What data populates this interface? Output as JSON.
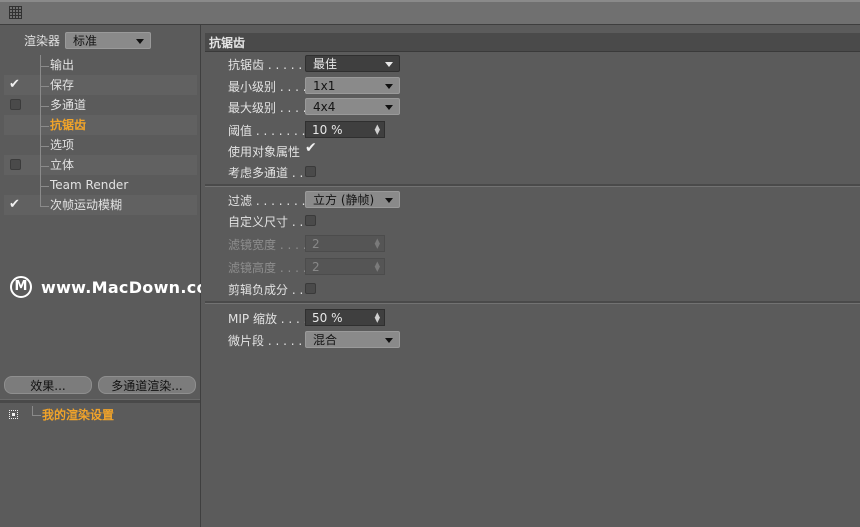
{
  "window": {
    "grip_icon": "grip-icon"
  },
  "sidebar": {
    "renderer_label": "渲染器",
    "renderer_value": "标准",
    "items": [
      {
        "label": "输出",
        "checkbox": false,
        "checked": false,
        "active": false
      },
      {
        "label": "保存",
        "checkbox": true,
        "checked": true,
        "active": false
      },
      {
        "label": "多通道",
        "checkbox": true,
        "checked": false,
        "active": false
      },
      {
        "label": "抗锯齿",
        "checkbox": false,
        "checked": false,
        "active": true
      },
      {
        "label": "选项",
        "checkbox": false,
        "checked": false,
        "active": false
      },
      {
        "label": "立体",
        "checkbox": true,
        "checked": false,
        "active": false
      },
      {
        "label": "Team Render",
        "checkbox": false,
        "checked": false,
        "active": false
      },
      {
        "label": "次帧运动模糊",
        "checkbox": true,
        "checked": true,
        "active": false
      }
    ],
    "effects_button": "效果...",
    "multipass_button": "多通道渲染...",
    "setting_name": "我的渲染设置"
  },
  "panel": {
    "section_title": "抗锯齿",
    "antialias_label": "抗锯齿 . . . . .",
    "antialias_value": "最佳",
    "min_level_label": "最小级别 . . . .",
    "min_level_value": "1x1",
    "max_level_label": "最大级别 . . . .",
    "max_level_value": "4x4",
    "threshold_label": "阈值 . . . . . . .",
    "threshold_value": "10 %",
    "use_object_props_label": "使用对象属性",
    "consider_multipass_label": "考虑多通道 . .",
    "filter_label": "过滤 . . . . . . .",
    "filter_value": "立方 (静帧)",
    "custom_size_label": "自定义尺寸 . .",
    "filter_width_label": "滤镜宽度 . . . .",
    "filter_width_value": "2",
    "filter_height_label": "滤镜高度 . . . .",
    "filter_height_value": "2",
    "clip_negative_label": "剪辑负成分 . .",
    "mip_scale_label": "MIP 缩放 . . . .",
    "mip_scale_value": "50 %",
    "micro_segment_label": "微片段 . . . . . .",
    "micro_segment_value": "混合"
  },
  "watermark": {
    "logo_letter": "M",
    "text": "www.MacDown.com"
  }
}
